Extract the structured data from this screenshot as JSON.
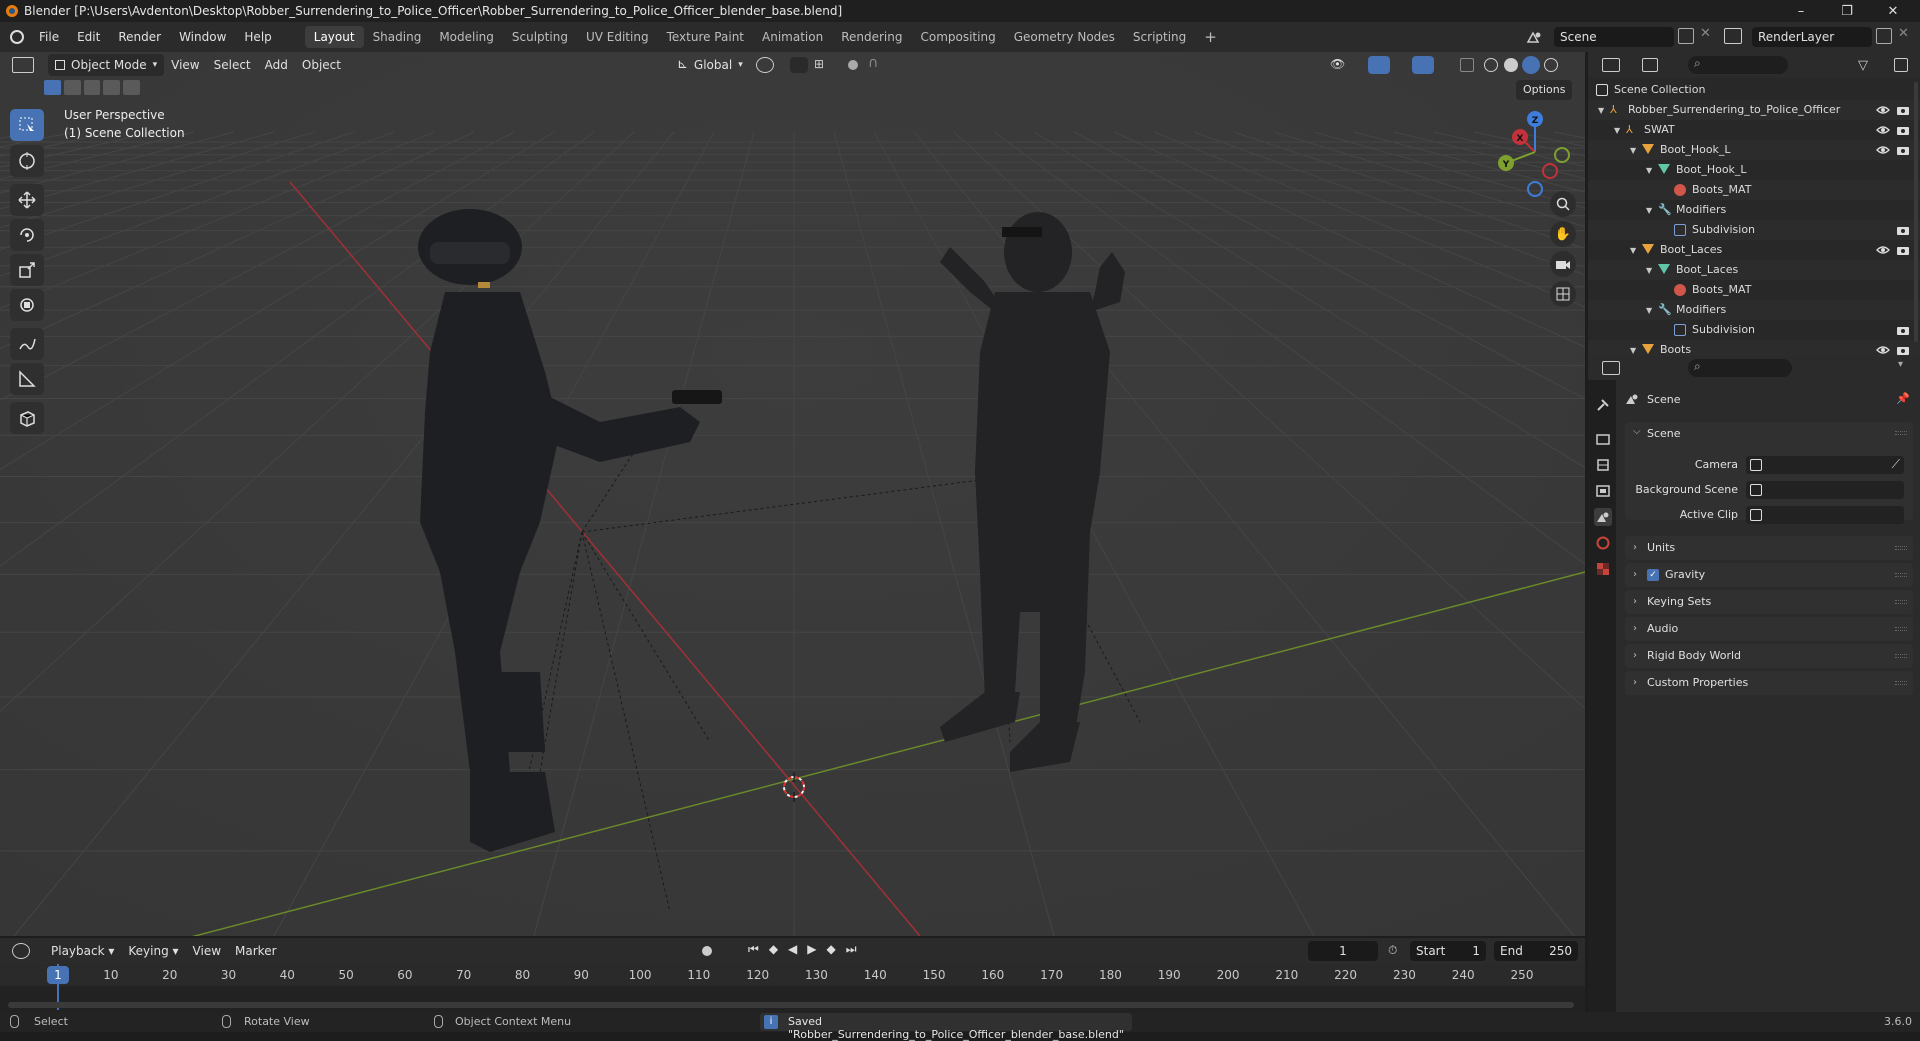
{
  "window": {
    "title": "Blender [P:\\Users\\Avdenton\\Desktop\\Robber_Surrendering_to_Police_Officer\\Robber_Surrendering_to_Police_Officer_blender_base.blend]",
    "minimize": "–",
    "maximize": "❐",
    "close": "✕"
  },
  "menu": [
    "File",
    "Edit",
    "Render",
    "Window",
    "Help"
  ],
  "workspaces": [
    "Layout",
    "Shading",
    "Modeling",
    "Sculpting",
    "UV Editing",
    "Texture Paint",
    "Animation",
    "Rendering",
    "Compositing",
    "Geometry Nodes",
    "Scripting"
  ],
  "workspace_add": "+",
  "scene_field": "Scene",
  "renderlayer_field": "RenderLayer",
  "viewport": {
    "mode": "Object Mode",
    "menus": [
      "View",
      "Select",
      "Add",
      "Object"
    ],
    "transform_orientation": "Global",
    "options": "Options",
    "overlay_line1": "User Perspective",
    "overlay_line2": "(1) Scene Collection",
    "gizmo_x": "X",
    "gizmo_y": "Y",
    "gizmo_z": "Z"
  },
  "outliner": {
    "rows": [
      {
        "label": "Scene Collection",
        "icon": "collection-icon"
      },
      {
        "label": "Robber_Surrendering_to_Police_Officer",
        "icon": "empty-icon"
      },
      {
        "label": "SWAT",
        "icon": "empty-icon"
      },
      {
        "label": "Boot_Hook_L",
        "icon": "mesh-object-icon"
      },
      {
        "label": "Boot_Hook_L",
        "icon": "mesh-data-icon"
      },
      {
        "label": "Boots_MAT",
        "icon": "material-icon"
      },
      {
        "label": "Modifiers",
        "icon": "wrench-icon"
      },
      {
        "label": "Subdivision",
        "icon": "subdivision-icon"
      },
      {
        "label": "Boot_Laces",
        "icon": "mesh-object-icon"
      },
      {
        "label": "Boot_Laces",
        "icon": "mesh-data-icon"
      },
      {
        "label": "Boots_MAT",
        "icon": "material-icon"
      },
      {
        "label": "Modifiers",
        "icon": "wrench-icon"
      },
      {
        "label": "Subdivision",
        "icon": "subdivision-icon"
      },
      {
        "label": "Boots",
        "icon": "mesh-object-icon"
      }
    ]
  },
  "properties": {
    "header": "Scene",
    "section": "Scene",
    "fields": [
      {
        "label": "Camera",
        "icon": "camera-object-icon"
      },
      {
        "label": "Background Scene",
        "icon": "scene-icon"
      },
      {
        "label": "Active Clip",
        "icon": "clip-icon"
      }
    ],
    "panels": [
      "Units",
      "Gravity",
      "Keying Sets",
      "Audio",
      "Rigid Body World",
      "Custom Properties"
    ],
    "gravity_checked": true
  },
  "timeline": {
    "menus": [
      "Playback",
      "Keying",
      "View",
      "Marker"
    ],
    "current_frame": "1",
    "start_label": "Start",
    "start": "1",
    "end_label": "End",
    "end": "250",
    "ticks": [
      "1",
      "10",
      "20",
      "30",
      "40",
      "50",
      "60",
      "70",
      "80",
      "90",
      "100",
      "110",
      "120",
      "130",
      "140",
      "150",
      "160",
      "170",
      "180",
      "190",
      "200",
      "210",
      "220",
      "230",
      "240",
      "250"
    ]
  },
  "statusbar": {
    "select": "Select",
    "rotate": "Rotate View",
    "context": "Object Context Menu",
    "message": "Saved \"Robber_Surrendering_to_Police_Officer_blender_base.blend\"",
    "version": "3.6.0"
  },
  "colors": {
    "accent": "#4772b3",
    "x_axis": "#c2323a",
    "y_axis": "#7ea02f",
    "z_axis": "#3e7ddb"
  }
}
